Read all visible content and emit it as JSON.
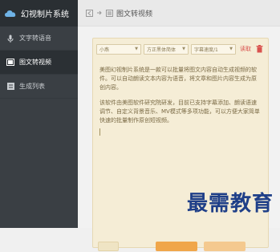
{
  "app": {
    "title": "幻视制片系统"
  },
  "sidebar": {
    "items": [
      {
        "label": "文字转语音",
        "icon": "microphone-icon",
        "active": false
      },
      {
        "label": "图文转视频",
        "icon": "video-icon",
        "active": true
      },
      {
        "label": "生成列表",
        "icon": "list-icon",
        "active": false
      }
    ]
  },
  "header": {
    "breadcrumb": "图文转视频",
    "icons": [
      "back-icon",
      "arrow-right-icon"
    ]
  },
  "editor": {
    "controls": [
      {
        "value": "小燕"
      },
      {
        "value": "方正黑体简体"
      },
      {
        "value": "字幕速度/1"
      }
    ],
    "clear_label": "读取",
    "paragraphs": [
      "美图幻视制片系统是一款可以批量将图文内容自动生成视频的软件。可以自动朗读文本内容为语音，将文章和图片内容生成为原创内容。",
      "该软件由美图软件研究院研发，目前已支持字幕添加、朗读语速调节、自定义背景音乐、MV模式等多项功能，可以方便大家简单快速的批量制作原创短视频。"
    ],
    "buttons": {
      "left": "",
      "mid": "",
      "right": ""
    }
  },
  "watermark": {
    "text": "最需教育"
  },
  "colors": {
    "sidebar_bg": "#3a3f44",
    "card_bg": "#f5edd6",
    "accent": "#f0a64a",
    "watermark": "#1f3f88"
  }
}
